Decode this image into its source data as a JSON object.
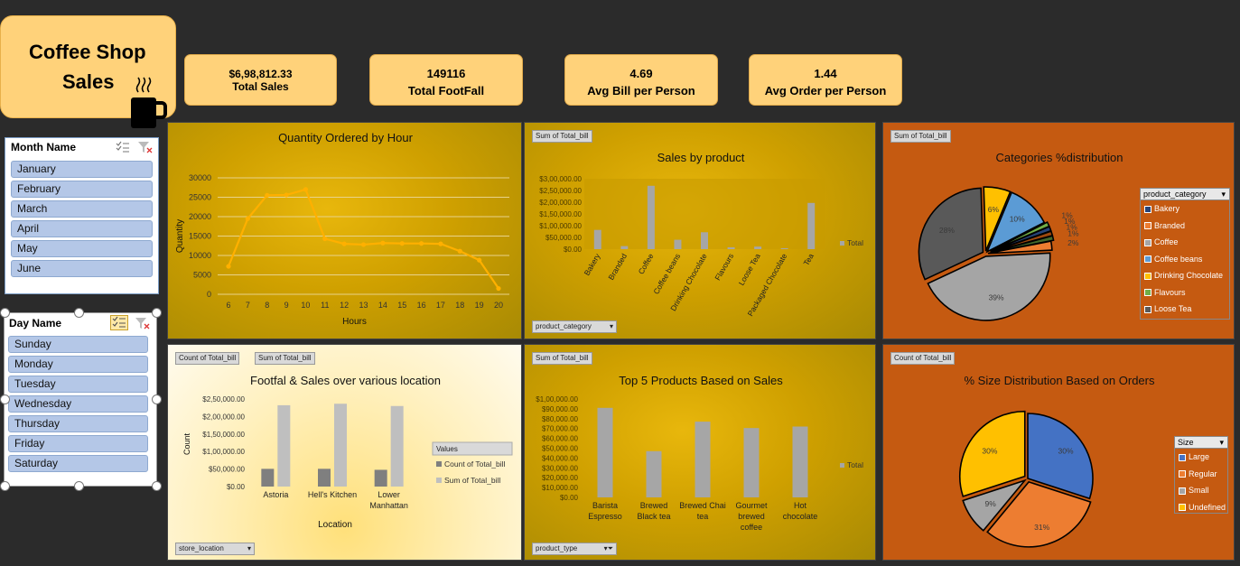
{
  "header": {
    "title_line1": "Coffee Shop",
    "title_line2": "Sales"
  },
  "kpis": [
    {
      "value": "$6,98,812.33",
      "label": "Total Sales"
    },
    {
      "value": "149116",
      "label": "Total FootFall"
    },
    {
      "value": "4.69",
      "label": "Avg Bill per Person"
    },
    {
      "value": "1.44",
      "label": "Avg Order per Person"
    }
  ],
  "month_slicer": {
    "header": "Month Name",
    "items": [
      "January",
      "February",
      "March",
      "April",
      "May",
      "June"
    ]
  },
  "day_slicer": {
    "header": "Day Name",
    "items": [
      "Sunday",
      "Monday",
      "Tuesday",
      "Wednesday",
      "Thursday",
      "Friday",
      "Saturday"
    ]
  },
  "colors": {
    "gold_panel": "#cfa000",
    "orange_panel": "#c55a11",
    "line": "#ffb000",
    "bar_gray": "#a6a6a6",
    "kpi_fill": "#ffd27a",
    "slicer_item": "#b4c7e7"
  },
  "panels": {
    "hourly": {
      "title": "Quantity Ordered by Hour"
    },
    "product": {
      "title": "Sales by product",
      "field_button": "Sum of Total_bill",
      "filter_button": "product_category",
      "legend_label": "Total"
    },
    "categories": {
      "title": "Categories %distribution",
      "field_button": "Sum of Total_bill",
      "legend_header": "product_category"
    },
    "location": {
      "title": "Footfal & Sales over various location",
      "field_button_1": "Count of Total_bill",
      "field_button_2": "Sum of Total_bill",
      "filter_button": "store_location",
      "legend_header": "Values"
    },
    "top5": {
      "title": "Top 5 Products Based on Sales",
      "field_button": "Sum of Total_bill",
      "filter_button": "product_type",
      "legend_label": "Total"
    },
    "size": {
      "title": "% Size Distribution Based on Orders",
      "field_button": "Count of Total_bill",
      "legend_header": "Size"
    }
  },
  "chart_data": [
    {
      "id": "hourly",
      "type": "line",
      "title": "Quantity Ordered by Hour",
      "xlabel": "Hours",
      "ylabel": "Quantity",
      "x": [
        6,
        7,
        8,
        9,
        10,
        11,
        12,
        13,
        14,
        15,
        16,
        17,
        18,
        19,
        20
      ],
      "series": [
        {
          "values": [
            7200,
            19500,
            25500,
            25600,
            27000,
            14300,
            13000,
            12800,
            13200,
            13100,
            13100,
            13000,
            11100,
            8800,
            1500
          ]
        }
      ],
      "ylim": [
        0,
        30000
      ],
      "yticks": [
        "0",
        "5000",
        "10000",
        "15000",
        "20000",
        "25000",
        "30000"
      ],
      "grid": true
    },
    {
      "id": "product",
      "type": "bar",
      "title": "Sales by product",
      "categories": [
        "Bakery",
        "Branded",
        "Coffee",
        "Coffee beans",
        "Drinking Chocolate",
        "Flavours",
        "Loose Tea",
        "Packaged Chocolate",
        "Tea"
      ],
      "series": [
        {
          "name": "Total",
          "values": [
            82000,
            13000,
            270000,
            40000,
            72000,
            8000,
            11000,
            4000,
            197000
          ]
        }
      ],
      "ylim": [
        0,
        300000
      ],
      "yticks": [
        "$0.00",
        "$50,000.00",
        "$1,00,000.00",
        "$1,50,000.00",
        "$2,00,000.00",
        "$2,50,000.00",
        "$3,00,000.00"
      ],
      "legend": "right"
    },
    {
      "id": "categories",
      "type": "pie",
      "title": "Categories %distribution",
      "labels": [
        "Coffee",
        "Tea",
        "Drinking Chocolate",
        "Bakery",
        "Coffee beans",
        "Packaged Chocolate",
        "Flavours",
        "Loose Tea",
        "Branded"
      ],
      "values": [
        39,
        28,
        6,
        10,
        1,
        1,
        1,
        1,
        2
      ],
      "data_labels": [
        "39%",
        "28%",
        "6%",
        "10%",
        "1%",
        "1%",
        "1%",
        "1%",
        "2%"
      ],
      "legend_entries": [
        "Bakery",
        "Branded",
        "Coffee",
        "Coffee beans",
        "Drinking Chocolate",
        "Flavours",
        "Loose Tea"
      ],
      "legend": "right"
    },
    {
      "id": "location",
      "type": "bar",
      "title": "Footfal & Sales over various location",
      "xlabel": "Location",
      "ylabel": "Count",
      "categories": [
        "Astoria",
        "Hell's Kitchen",
        "Lower Manhattan"
      ],
      "series": [
        {
          "name": "Count of Total_bill",
          "values": [
            50600,
            50700,
            47800
          ]
        },
        {
          "name": "Sum of Total_bill",
          "values": [
            232200,
            236500,
            230000
          ]
        }
      ],
      "ylim": [
        0,
        250000
      ],
      "yticks": [
        "$0.00",
        "$50,000.00",
        "$1,00,000.00",
        "$1,50,000.00",
        "$2,00,000.00",
        "$2,50,000.00"
      ],
      "legend": "right"
    },
    {
      "id": "top5",
      "type": "bar",
      "title": "Top 5 Products Based on Sales",
      "categories": [
        "Barista Espresso",
        "Brewed Black tea",
        "Brewed Chai tea",
        "Gourmet brewed coffee",
        "Hot chocolate"
      ],
      "series": [
        {
          "name": "Total",
          "values": [
            91000,
            47000,
            77000,
            70500,
            72000
          ]
        }
      ],
      "ylim": [
        0,
        100000
      ],
      "yticks": [
        "$0.00",
        "$10,000.00",
        "$20,000.00",
        "$30,000.00",
        "$40,000.00",
        "$50,000.00",
        "$60,000.00",
        "$70,000.00",
        "$80,000.00",
        "$90,000.00",
        "$1,00,000.00"
      ],
      "legend": "right"
    },
    {
      "id": "size",
      "type": "pie",
      "title": "% Size Distribution Based on Orders",
      "labels": [
        "Large",
        "Regular",
        "Small",
        "Undefined"
      ],
      "values": [
        30,
        31,
        9,
        30
      ],
      "data_labels": [
        "30%",
        "31%",
        "9%",
        "30%"
      ],
      "legend_entries": [
        "Large",
        "Regular",
        "Small",
        "Undefined"
      ],
      "legend": "right"
    }
  ]
}
